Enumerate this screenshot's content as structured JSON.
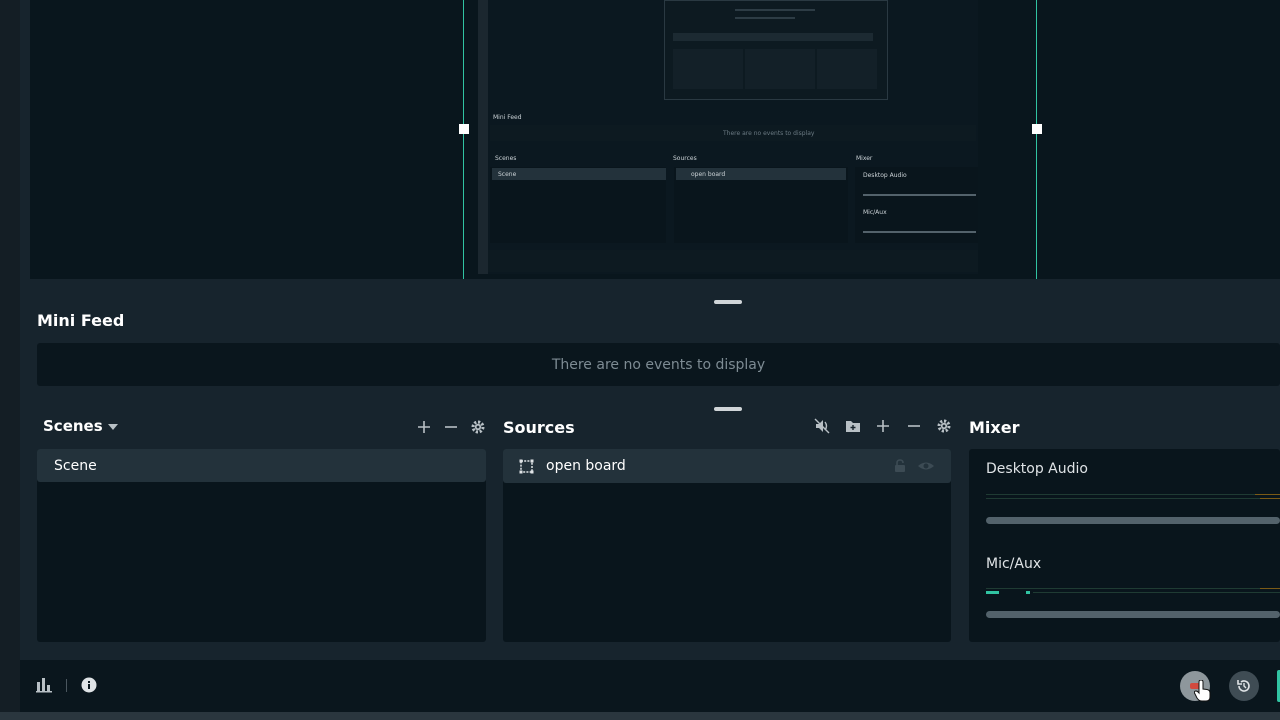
{
  "nested_preview": {
    "minifeed_title": "Mini Feed",
    "minifeed_empty": "There are no events to display",
    "scenes_title": "Scenes",
    "scene_item": "Scene",
    "sources_title": "Sources",
    "source_item": "open board",
    "mixer_title": "Mixer",
    "desktop_audio": "Desktop Audio",
    "mic_aux": "Mic/Aux"
  },
  "minifeed": {
    "title": "Mini Feed",
    "empty_message": "There are no events to display"
  },
  "scenes": {
    "title": "Scenes",
    "items": [
      {
        "label": "Scene"
      }
    ]
  },
  "sources": {
    "title": "Sources",
    "items": [
      {
        "label": "open board"
      }
    ]
  },
  "mixer": {
    "title": "Mixer",
    "channels": [
      {
        "label": "Desktop Audio",
        "volume": 0.98
      },
      {
        "label": "Mic/Aux",
        "volume": 0.98
      }
    ]
  },
  "colors": {
    "accent": "#31c3a2",
    "background": "#17242d",
    "panel": "#09151c",
    "row": "#23323b"
  },
  "icons": {
    "footer_left": [
      "bar-chart-icon",
      "info-icon"
    ],
    "footer_right": [
      "record-button-icon",
      "replay-icon"
    ]
  }
}
